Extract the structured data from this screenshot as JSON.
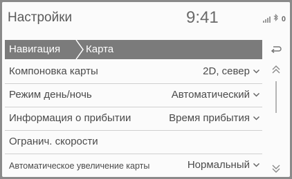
{
  "header": {
    "title": "Настройки",
    "time": "9:41",
    "icons": [
      "signal-strength-icon",
      "bluetooth-icon",
      "lock-icon"
    ],
    "lock_glyph": "0"
  },
  "breadcrumb": {
    "items": [
      "Навигация",
      "Карта"
    ]
  },
  "settings": [
    {
      "label": "Компоновка карты",
      "value": "2D, север"
    },
    {
      "label": "Режим день/ночь",
      "value": "Автоматический"
    },
    {
      "label": "Информация о прибытии",
      "value": "Время прибытия"
    },
    {
      "label": "Огранич. скорости",
      "value": ""
    },
    {
      "label": "Автоматическое увеличение карты",
      "value": "Нормальный"
    }
  ],
  "colors": {
    "breadcrumb_bg": "#7b7b7b",
    "screen_bg": "#fbfbfb",
    "text": "#4a4a4a"
  }
}
